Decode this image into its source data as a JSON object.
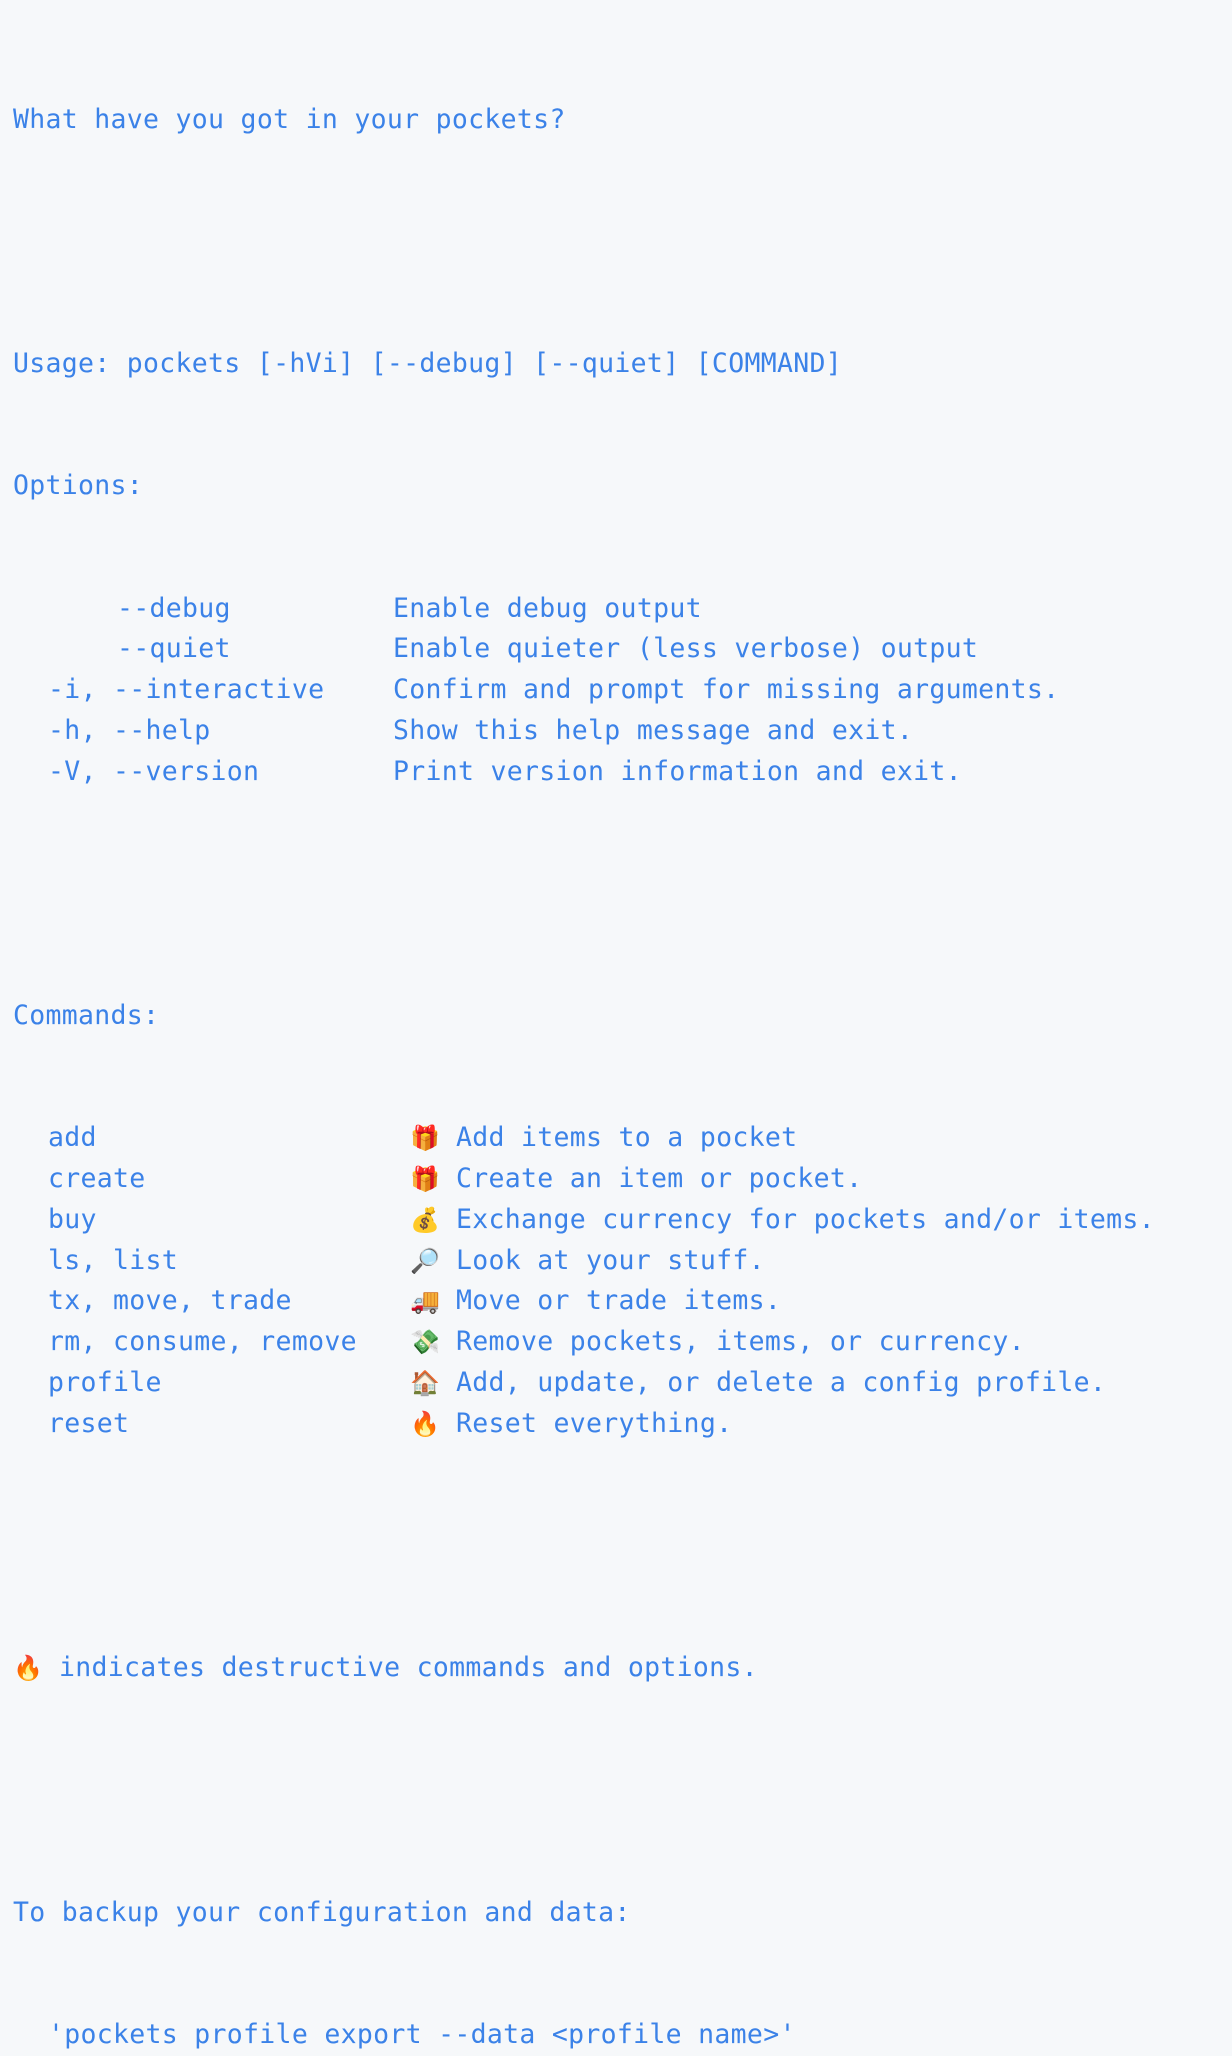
{
  "intro": "What have you got in your pockets?",
  "usage": "Usage: pockets [-hVi] [--debug] [--quiet] [COMMAND]",
  "options_header": "Options:",
  "options": [
    {
      "flag": "--debug",
      "long_only": true,
      "description": "Enable debug output"
    },
    {
      "flag": "--quiet",
      "long_only": true,
      "description": "Enable quieter (less verbose) output"
    },
    {
      "flag": "-i, --interactive",
      "long_only": false,
      "description": "Confirm and prompt for missing arguments."
    },
    {
      "flag": "-h, --help",
      "long_only": false,
      "description": "Show this help message and exit."
    },
    {
      "flag": "-V, --version",
      "long_only": false,
      "description": "Print version information and exit."
    }
  ],
  "commands_header": "Commands:",
  "commands": [
    {
      "name": "add",
      "icon": "🎁",
      "icon_name": "gift-icon",
      "description": "Add items to a pocket"
    },
    {
      "name": "create",
      "icon": "🎁",
      "icon_name": "gift-icon",
      "description": "Create an item or pocket."
    },
    {
      "name": "buy",
      "icon": "💰",
      "icon_name": "money-bag-icon",
      "description": "Exchange currency for pockets and/or items."
    },
    {
      "name": "ls, list",
      "icon": "🔎",
      "icon_name": "magnifier-icon",
      "description": "Look at your stuff."
    },
    {
      "name": "tx, move, trade",
      "icon": "🚚",
      "icon_name": "delivery-truck-icon",
      "description": "Move or trade items."
    },
    {
      "name": "rm, consume, remove",
      "icon": "💸",
      "icon_name": "money-with-wings-icon",
      "description": "Remove pockets, items, or currency."
    },
    {
      "name": "profile",
      "icon": "🏠",
      "icon_name": "house-icon",
      "description": "Add, update, or delete a config profile."
    },
    {
      "name": "reset",
      "icon": "🔥",
      "icon_name": "fire-icon",
      "description": "Reset everything."
    }
  ],
  "note": {
    "icon": "🔥",
    "icon_name": "fire-icon",
    "text": "indicates destructive commands and options."
  },
  "backup": {
    "header": "To backup your configuration and data:",
    "command": "'pockets profile export --data <profile name>'"
  },
  "colors": {
    "text": "#3b82e8",
    "background": "#f6f8fa"
  }
}
